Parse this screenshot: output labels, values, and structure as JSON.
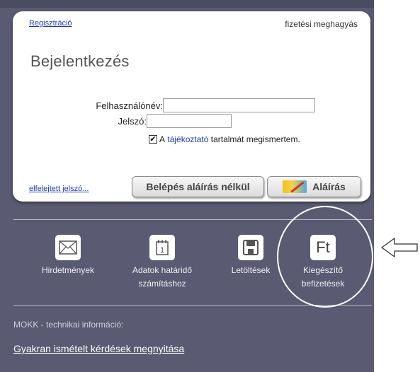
{
  "card": {
    "registration_link": "Regisztráció",
    "payment_text": "fizetési meghagyás",
    "title": "Bejelentkezés",
    "username_label": "Felhasználónév:",
    "username_value": "",
    "password_label": "Jelszó:",
    "password_value": "",
    "consent_checked": true,
    "consent_prefix": "A",
    "consent_link": "tájékoztató",
    "consent_suffix": "tartalmát megismertem.",
    "forgot_password_link": "elfelejtett jelszó...",
    "login_button": "Belépés aláírás nélkül",
    "sign_button": "Aláírás"
  },
  "tiles": [
    {
      "label_line1": "Hirdetmények",
      "label_line2": "",
      "icon": "envelope-icon"
    },
    {
      "label_line1": "Adatok határidő",
      "label_line2": "számításhoz",
      "icon": "calendar-icon"
    },
    {
      "label_line1": "Letöltések",
      "label_line2": "",
      "icon": "floppy-disk-icon"
    },
    {
      "label_line1": "Kiegészítő",
      "label_line2": "befizetések",
      "icon_text": "Ft"
    }
  ],
  "info": {
    "title": "MOKK - technikai információ:",
    "faq_link": "Gyakran ismételt kérdések megnyitása"
  },
  "colors": {
    "panel_background": "#5a5a72",
    "link": "#1f3bb3",
    "card_background": "#ffffff"
  }
}
